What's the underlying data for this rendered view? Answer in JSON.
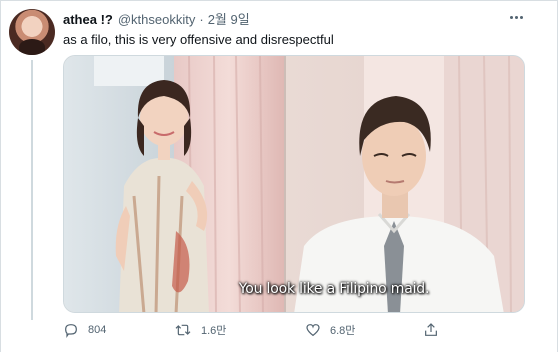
{
  "tweet": {
    "display_name": "athea !?",
    "handle": "@kthseokkity",
    "separator": "·",
    "date": "2월 9일",
    "text": "as a filo, this is very offensive and disrespectful",
    "media": {
      "subtitle": "You look like a Filipino maid."
    }
  },
  "actions": {
    "reply_count": "804",
    "retweet_count": "1.6만",
    "like_count": "6.8만"
  },
  "icons": {
    "more": "more-dots-icon",
    "reply": "reply-icon",
    "retweet": "retweet-icon",
    "like": "heart-icon",
    "share": "share-icon"
  },
  "colors": {
    "text_primary": "#0f1419",
    "text_secondary": "#536471",
    "border": "#cfd9de"
  }
}
